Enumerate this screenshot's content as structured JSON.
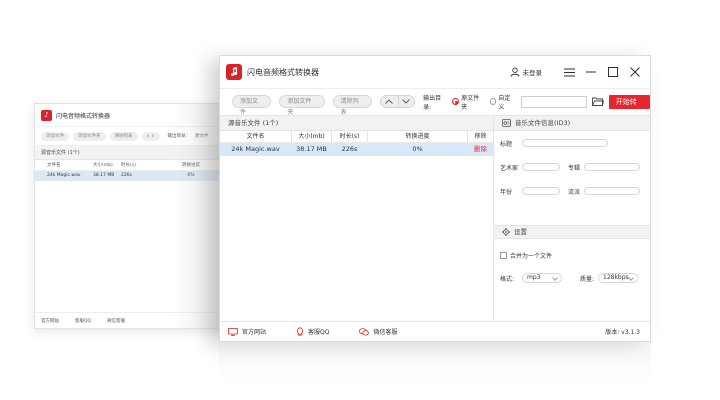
{
  "app": {
    "title": "闪电音频格式转换器",
    "user_label": "未登录",
    "accent": "#e5262c"
  },
  "toolbar": {
    "add_file": "添加文件",
    "add_folder": "添加文件夹",
    "clear_list": "清除列表",
    "output_label": "输出目录:",
    "radio_source": "原文件夹",
    "radio_custom": "自定义",
    "path_value": "",
    "start_label": "开始转换"
  },
  "file_list": {
    "header": "源音乐文件 (1个)",
    "columns": [
      "文件名",
      "大小(mb)",
      "时长(s)",
      "转换进度",
      "移除"
    ],
    "rows": [
      {
        "name": "24k Magic.wav",
        "size": "38.17 MB",
        "duration": "226s",
        "progress": "0%",
        "remove": "删除"
      }
    ]
  },
  "id3": {
    "header": "音乐文件信息(ID3)",
    "title_label": "标题",
    "artist_label": "艺术家",
    "album_label": "专辑",
    "year_label": "年份",
    "genre_label": "流派"
  },
  "settings": {
    "header": "设置",
    "merge_label": "合并为一个文件",
    "format_label": "格式:",
    "format_value": "mp3",
    "quality_label": "质量:",
    "quality_value": "128kbps"
  },
  "footer": {
    "website": "官方网站",
    "qq": "客服QQ",
    "wechat": "微信客服",
    "version": "版本: v3.1.3"
  },
  "ghost": {
    "title": "闪电音频格式转换器",
    "add_file": "添加文件",
    "add_folder": "添加文件夹",
    "clear_list": "清除列表",
    "output_label": "输出目录:",
    "radio_source": "原文件",
    "section": "源音乐文件 (1个)",
    "col_name": "文件名",
    "col_size": "大小(mb)",
    "col_dur": "时长(s)",
    "col_prog": "转换进度",
    "row_name": "24k Magic.wav",
    "row_size": "38.17 MB",
    "row_dur": "226s",
    "row_prog": "0%",
    "website": "官方网站",
    "qq": "客服QQ",
    "wechat": "微信客服"
  }
}
